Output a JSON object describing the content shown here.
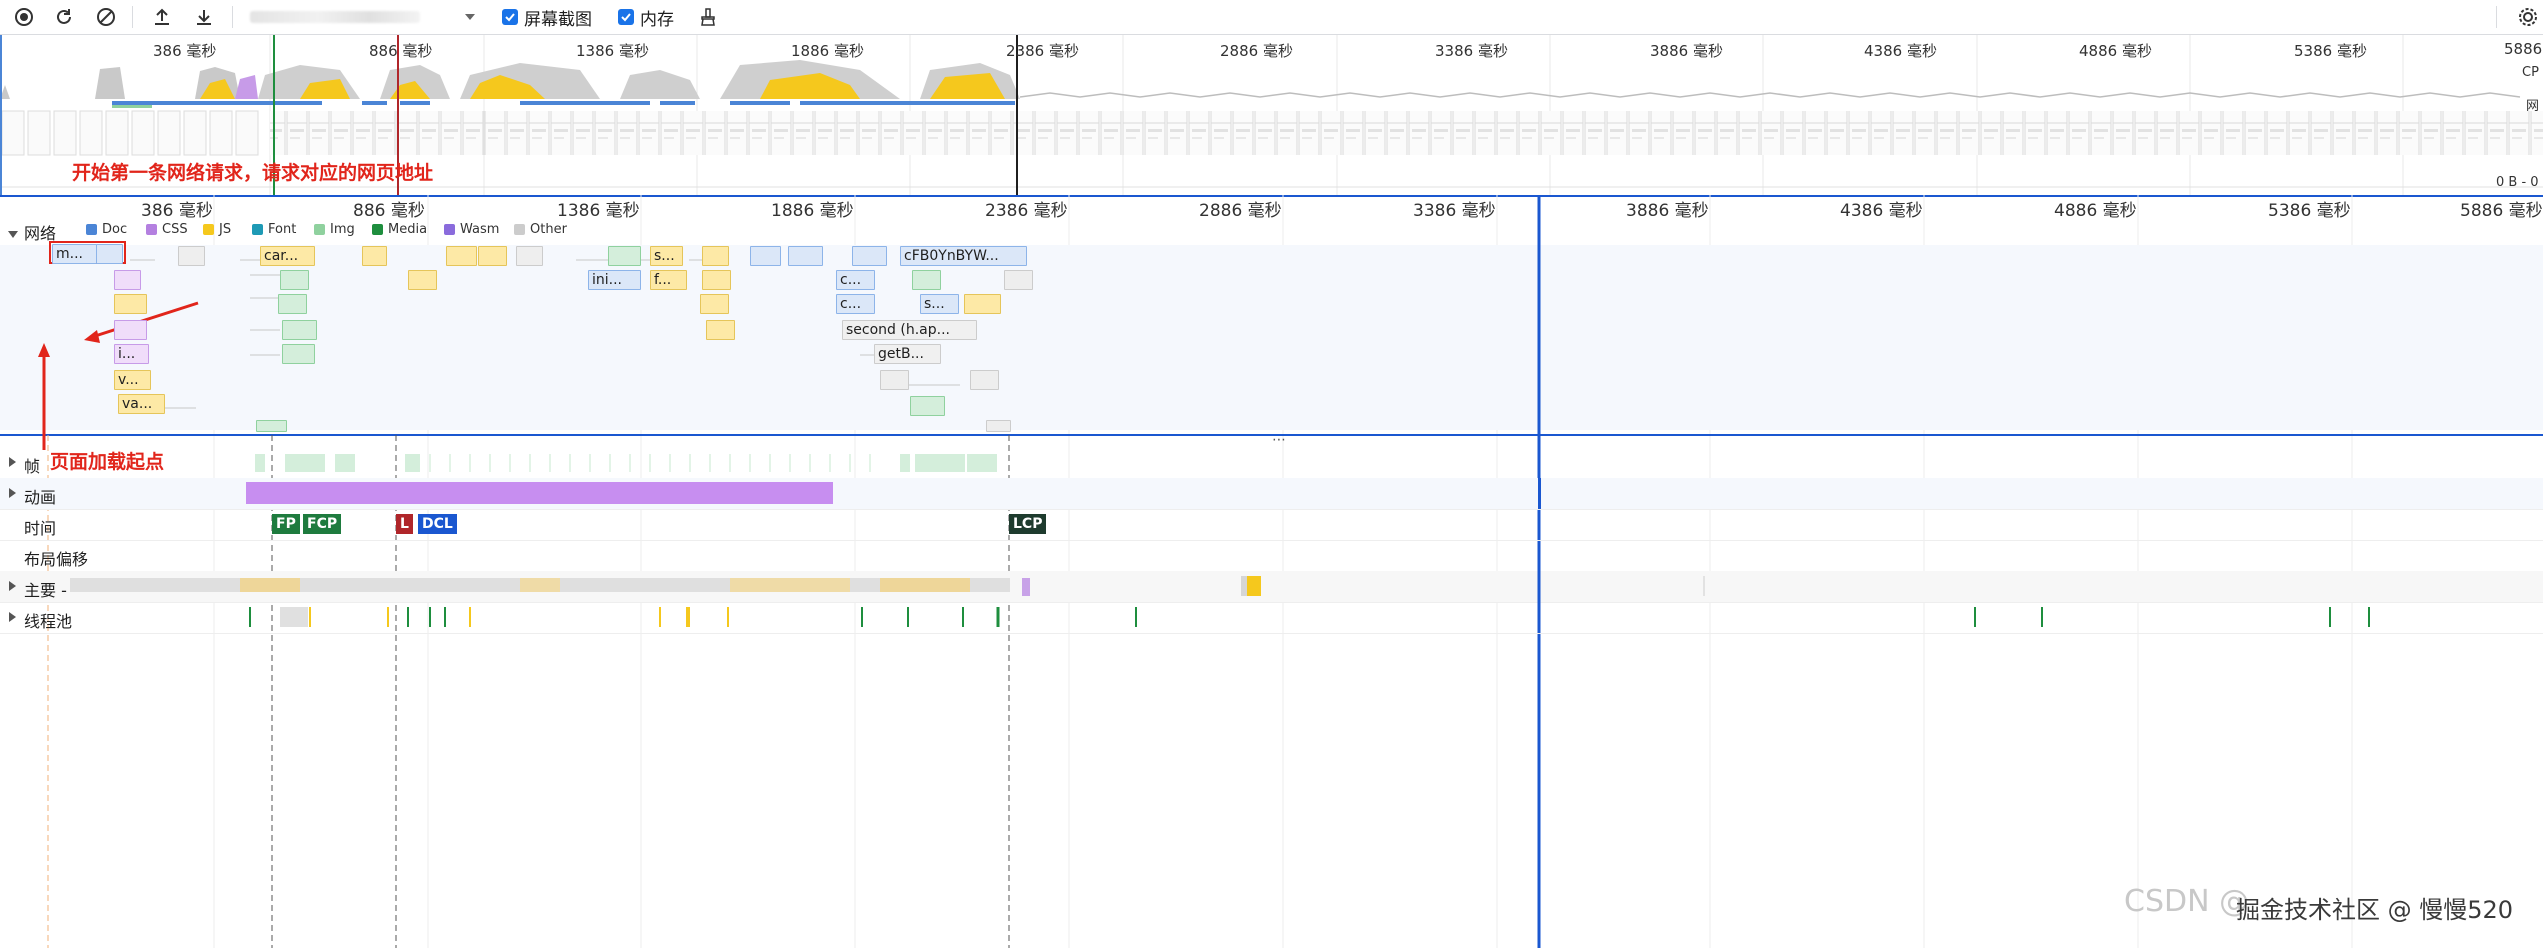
{
  "toolbar": {
    "screenshot_label": "屏幕截图",
    "memory_label": "内存",
    "screenshot_checked": true,
    "memory_checked": true
  },
  "overview": {
    "ruler": [
      "386 毫秒",
      "886 毫秒",
      "1386 毫秒",
      "1886 毫秒",
      "2386 毫秒",
      "2886 毫秒",
      "3386 毫秒",
      "3886 毫秒",
      "4386 毫秒",
      "4886 毫秒",
      "5386 毫秒",
      "5886"
    ],
    "cpu_label": "CP",
    "net_label": "网",
    "mem_label": "0 B - 0"
  },
  "timeline": {
    "ruler": [
      "386 毫秒",
      "886 毫秒",
      "1386 毫秒",
      "1886 毫秒",
      "2386 毫秒",
      "2886 毫秒",
      "3386 毫秒",
      "3886 毫秒",
      "4386 毫秒",
      "4886 毫秒",
      "5386 毫秒",
      "5886 毫秒"
    ],
    "network_label": "网络",
    "legend": [
      {
        "label": "Doc",
        "color": "#4b85d6"
      },
      {
        "label": "CSS",
        "color": "#b480e0"
      },
      {
        "label": "JS",
        "color": "#f5c81d"
      },
      {
        "label": "Font",
        "color": "#1e9ab5"
      },
      {
        "label": "Img",
        "color": "#8fd19e"
      },
      {
        "label": "Media",
        "color": "#1e8e3e"
      },
      {
        "label": "Wasm",
        "color": "#8a6bdc"
      },
      {
        "label": "Other",
        "color": "#cccccc"
      }
    ],
    "requests": {
      "r1": "m...",
      "r2": "car...",
      "r3": "s...",
      "r4": "ini...",
      "r5": "f...",
      "r6": "cFB0YnBYW...",
      "r7": "c...",
      "r8": "c...",
      "r9": "s...",
      "r10": "second (h.ap...",
      "r11": "getB...",
      "r12": "i...",
      "r13": "v...",
      "r14": "va..."
    },
    "tracks": {
      "frames": "帧",
      "animation": "动画",
      "timings": "时间",
      "layout_shift": "布局偏移",
      "main": "主要 -",
      "thread_pool": "线程池"
    },
    "markers": {
      "fp": "FP",
      "fcp": "FCP",
      "l": "L",
      "dcl": "DCL",
      "lcp": "LCP"
    }
  },
  "annotations": {
    "first_request": "开始第一条网络请求，请求对应的网页地址",
    "page_start": "页面加载起点"
  },
  "watermark": {
    "left": "CSDN @",
    "right": "掘金技术社区 @ 慢慢520"
  }
}
